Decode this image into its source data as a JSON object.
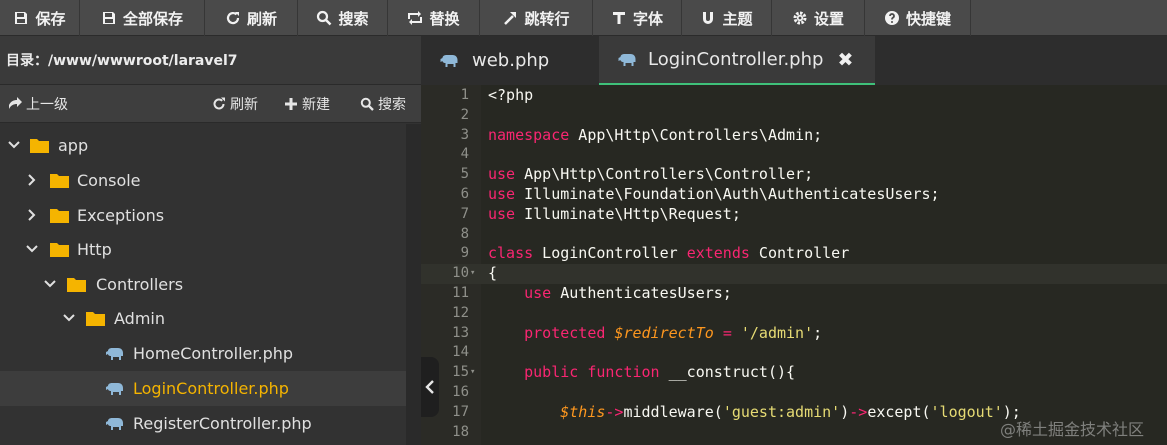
{
  "toolbar": {
    "buttons": [
      {
        "label": "保存",
        "icon": "save-icon"
      },
      {
        "label": "全部保存",
        "icon": "save-all-icon"
      },
      {
        "label": "刷新",
        "icon": "refresh-icon"
      },
      {
        "label": "搜索",
        "icon": "search-icon"
      },
      {
        "label": "替换",
        "icon": "replace-icon"
      },
      {
        "label": "跳转行",
        "icon": "jump-icon"
      },
      {
        "label": "字体",
        "icon": "font-icon"
      },
      {
        "label": "主题",
        "icon": "theme-icon"
      },
      {
        "label": "设置",
        "icon": "gear-icon"
      },
      {
        "label": "快捷键",
        "icon": "help-icon"
      }
    ]
  },
  "explorer": {
    "directory_label": "目录：/www/wwwroot/laravel7",
    "actions": {
      "up": "上一级",
      "refresh": "刷新",
      "new": "新建",
      "search": "搜索"
    },
    "tree": [
      {
        "label": "app",
        "type": "folder",
        "expanded": true
      },
      {
        "label": "Console",
        "type": "folder",
        "expanded": false
      },
      {
        "label": "Exceptions",
        "type": "folder",
        "expanded": false
      },
      {
        "label": "Http",
        "type": "folder",
        "expanded": true
      },
      {
        "label": "Controllers",
        "type": "folder",
        "expanded": true
      },
      {
        "label": "Admin",
        "type": "folder",
        "expanded": true
      },
      {
        "label": "HomeController.php",
        "type": "file"
      },
      {
        "label": "LoginController.php",
        "type": "file",
        "selected": true
      },
      {
        "label": "RegisterController.php",
        "type": "file"
      }
    ]
  },
  "editor": {
    "tabs": [
      {
        "label": "web.php",
        "active": false
      },
      {
        "label": "LoginController.php",
        "active": true
      }
    ],
    "current_line": 10,
    "lines": [
      {
        "n": "1",
        "text": "<?php"
      },
      {
        "n": "2",
        "text": ""
      },
      {
        "n": "3",
        "text": "namespace App\\Http\\Controllers\\Admin;"
      },
      {
        "n": "4",
        "text": ""
      },
      {
        "n": "5",
        "text": "use App\\Http\\Controllers\\Controller;"
      },
      {
        "n": "6",
        "text": "use Illuminate\\Foundation\\Auth\\AuthenticatesUsers;"
      },
      {
        "n": "7",
        "text": "use Illuminate\\Http\\Request;"
      },
      {
        "n": "8",
        "text": ""
      },
      {
        "n": "9",
        "text": "class LoginController extends Controller"
      },
      {
        "n": "10",
        "text": "{"
      },
      {
        "n": "11",
        "text": "    use AuthenticatesUsers;"
      },
      {
        "n": "12",
        "text": ""
      },
      {
        "n": "13",
        "text": "    protected $redirectTo = '/admin';"
      },
      {
        "n": "14",
        "text": ""
      },
      {
        "n": "15",
        "text": "    public function __construct(){"
      },
      {
        "n": "16",
        "text": ""
      },
      {
        "n": "17",
        "text": "        $this->middleware('guest:admin')->except('logout');"
      },
      {
        "n": "18",
        "text": ""
      }
    ]
  },
  "watermark": "@稀土掘金技术社区",
  "colors": {
    "keyword": "#f92672",
    "string": "#e6db74",
    "variable": "#fd971f",
    "folder": "#f5b400",
    "php_icon": "#8fb8d8",
    "active_tab_underline": "#3fc17a"
  }
}
